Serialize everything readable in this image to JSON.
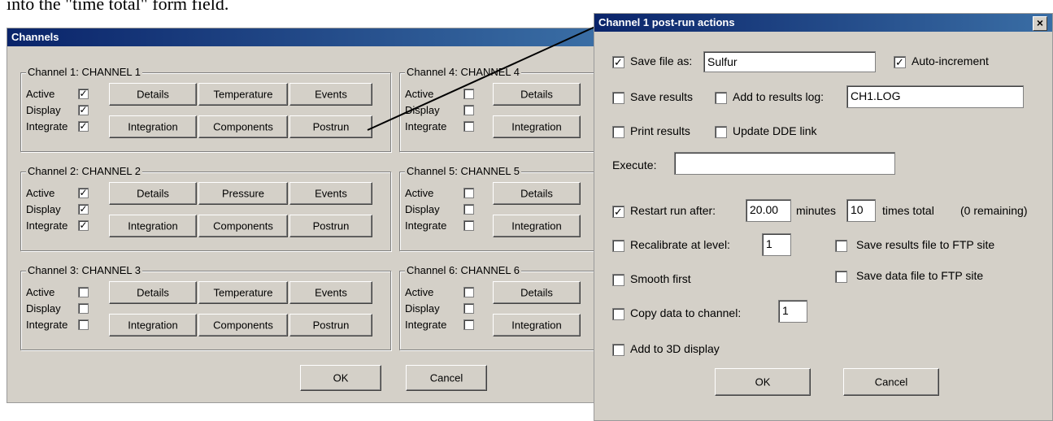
{
  "document": {
    "text": "into the \"time total\" form field."
  },
  "channels_dialog": {
    "title": "Channels",
    "row_labels": {
      "active": "Active",
      "display": "Display",
      "integrate": "Integrate"
    },
    "check_glyph": "✓",
    "channels": [
      {
        "title": "Channel 1: CHANNEL 1",
        "active": true,
        "display": true,
        "integrate": true,
        "buttons": [
          "Details",
          "Temperature",
          "Events",
          "Integration",
          "Components",
          "Postrun"
        ]
      },
      {
        "title": "Channel 2: CHANNEL 2",
        "active": true,
        "display": true,
        "integrate": true,
        "buttons": [
          "Details",
          "Pressure",
          "Events",
          "Integration",
          "Components",
          "Postrun"
        ]
      },
      {
        "title": "Channel 3: CHANNEL 3",
        "active": false,
        "display": false,
        "integrate": false,
        "buttons": [
          "Details",
          "Temperature",
          "Events",
          "Integration",
          "Components",
          "Postrun"
        ]
      },
      {
        "title": "Channel 4: CHANNEL 4",
        "active": false,
        "display": false,
        "integrate": false,
        "buttons": [
          "Details",
          "Integration"
        ]
      },
      {
        "title": "Channel 5: CHANNEL 5",
        "active": false,
        "display": false,
        "integrate": false,
        "buttons": [
          "Details",
          "Integration"
        ]
      },
      {
        "title": "Channel 6: CHANNEL 6",
        "active": false,
        "display": false,
        "integrate": false,
        "buttons": [
          "Details",
          "Integration"
        ]
      }
    ],
    "ok_label": "OK",
    "cancel_label": "Cancel"
  },
  "postrun_dialog": {
    "title": "Channel 1 post-run actions",
    "close_glyph": "×",
    "save_file_as": {
      "label": "Save file as:",
      "checked": true,
      "value": "Sulfur"
    },
    "auto_increment": {
      "label": "Auto-increment",
      "checked": true
    },
    "save_results": {
      "label": "Save results",
      "checked": false
    },
    "add_to_results_log": {
      "label": "Add to results log:",
      "checked": false,
      "value": "CH1.LOG"
    },
    "print_results": {
      "label": "Print results",
      "checked": false
    },
    "update_dde_link": {
      "label": "Update DDE link",
      "checked": false
    },
    "execute": {
      "label": "Execute:",
      "value": ""
    },
    "restart_run": {
      "label": "Restart run after:",
      "checked": true,
      "minutes_value": "20.00",
      "minutes_label": "minutes",
      "times_value": "10",
      "times_label": "times total",
      "remaining_label": "(0 remaining)"
    },
    "recalibrate": {
      "label": "Recalibrate at level:",
      "checked": false,
      "value": "1"
    },
    "save_results_ftp": {
      "label": "Save results file to FTP site",
      "checked": false
    },
    "smooth_first": {
      "label": "Smooth first",
      "checked": false
    },
    "save_data_ftp": {
      "label": "Save data file to FTP site",
      "checked": false
    },
    "copy_data": {
      "label": "Copy data to channel:",
      "checked": false,
      "value": "1"
    },
    "add_3d": {
      "label": "Add to 3D display",
      "checked": false
    },
    "ok_label": "OK",
    "cancel_label": "Cancel"
  }
}
